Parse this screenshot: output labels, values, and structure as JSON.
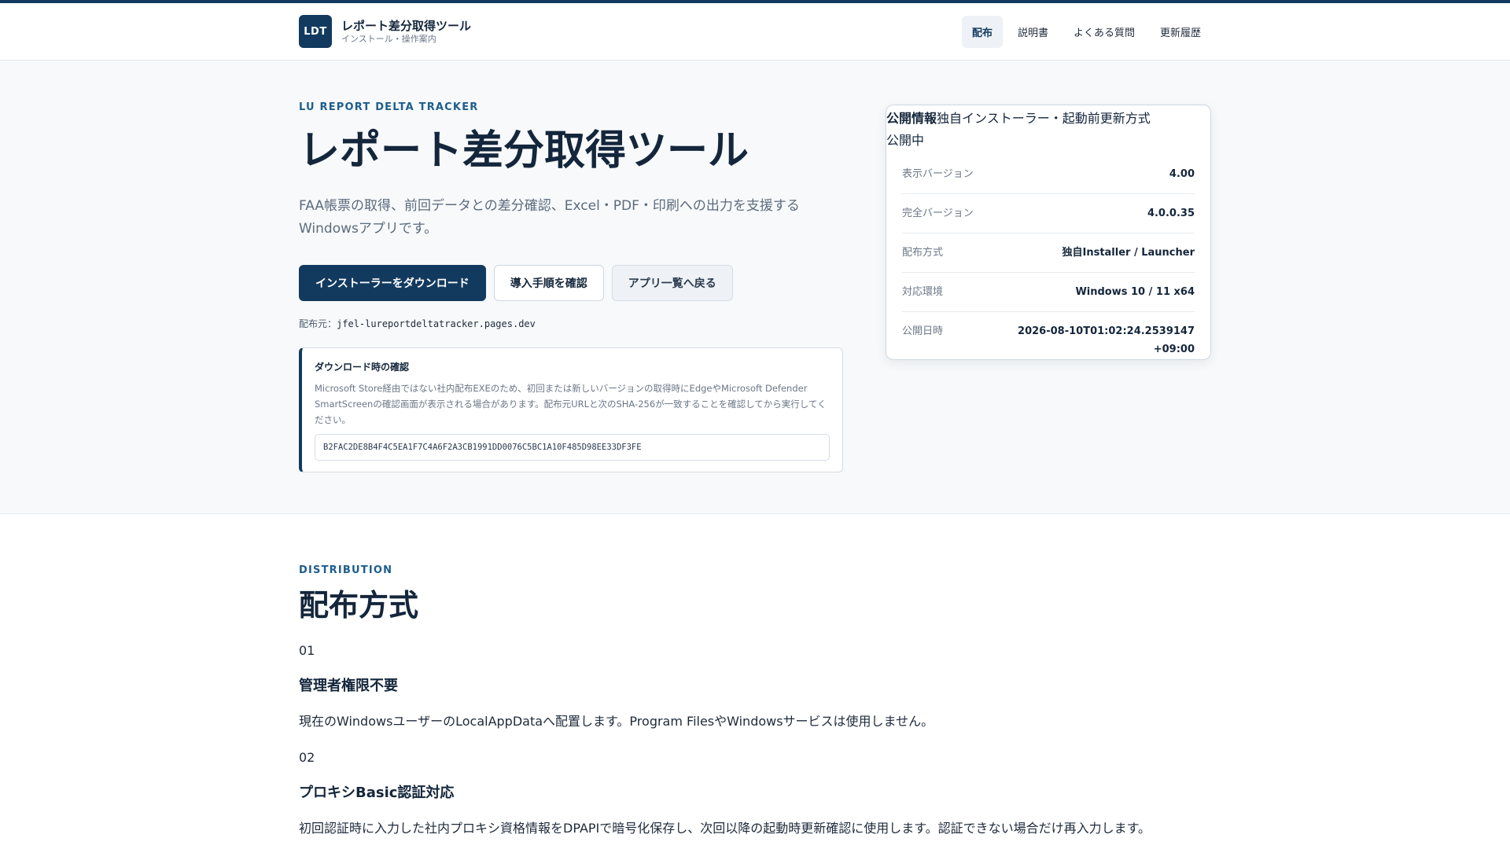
{
  "header": {
    "logo_text": "LDT",
    "brand_title": "レポート差分取得ツール",
    "brand_sub": "インストール・操作案内",
    "nav": [
      {
        "label": "配布"
      },
      {
        "label": "説明書"
      },
      {
        "label": "よくある質問"
      },
      {
        "label": "更新履歴"
      }
    ]
  },
  "hero": {
    "eyebrow": "LU REPORT DELTA TRACKER",
    "title": "レポート差分取得ツール",
    "description": "FAA帳票の取得、前回データとの差分確認、Excel・PDF・印刷への出力を支援するWindowsアプリです。",
    "buttons": {
      "download": "インストーラーをダウンロード",
      "guide": "導入手順を確認",
      "back": "アプリ一覧へ戻る"
    },
    "source_label": "配布元：",
    "source_value": "jfel-lureportdeltatracker.pages.dev",
    "notice": {
      "title": "ダウンロード時の確認",
      "body": "Microsoft Store経由ではない社内配布EXEのため、初回または新しいバージョンの取得時にEdgeやMicrosoft Defender SmartScreenの確認画面が表示される場合があります。配布元URLと次のSHA-256が一致することを確認してから実行してください。",
      "hash": "B2FAC2DE8B4F4C5EA1F7C4A6F2A3CB1991DD0076C5BC1A10F485D98EE33DF3FE"
    }
  },
  "info_card": {
    "head_bold": "公開情報",
    "head_rest": "独自インストーラー・起動前更新方式",
    "status": "公開中",
    "rows": [
      {
        "key": "表示バージョン",
        "value": "4.00"
      },
      {
        "key": "完全バージョン",
        "value": "4.0.0.35"
      },
      {
        "key": "配布方式",
        "value": "独自Installer / Launcher"
      },
      {
        "key": "対応環境",
        "value": "Windows 10 / 11 x64"
      },
      {
        "key": "公開日時",
        "value": "2026-08-10T01:02:24.2539147+09:00"
      }
    ]
  },
  "distribution": {
    "eyebrow": "DISTRIBUTION",
    "title": "配布方式",
    "features": [
      {
        "num": "01",
        "title": "管理者権限不要",
        "desc": "現在のWindowsユーザーのLocalAppDataへ配置します。Program FilesやWindowsサービスは使用しません。"
      },
      {
        "num": "02",
        "title": "プロキシBasic認証対応",
        "desc": "初回認証時に入力した社内プロキシ資格情報をDPAPIで暗号化保存し、次回以降の起動時更新確認に使用します。認証できない場合だけ再入力します。"
      }
    ]
  }
}
